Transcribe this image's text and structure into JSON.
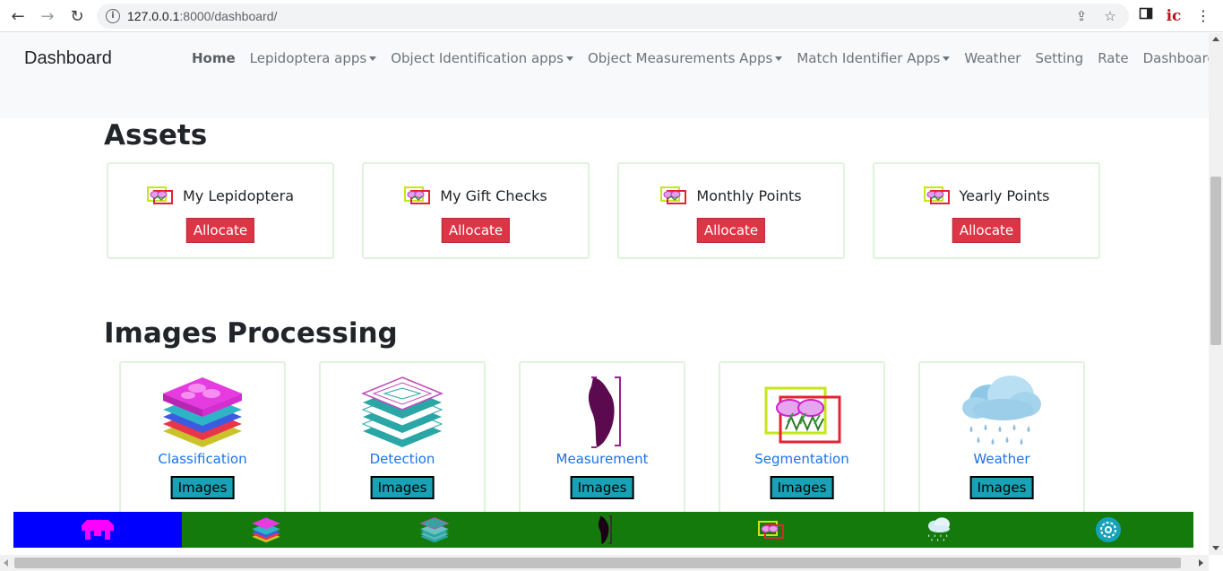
{
  "browser": {
    "url_host": "127.0.0.1",
    "url_rest": ":8000/dashboard/",
    "ext_label": "ic"
  },
  "navbar": {
    "brand": "Dashboard",
    "links": [
      {
        "label": "Home",
        "dropdown": false,
        "active": true
      },
      {
        "label": "Lepidoptera apps",
        "dropdown": true
      },
      {
        "label": "Object Identification apps",
        "dropdown": true
      },
      {
        "label": "Object Measurements Apps",
        "dropdown": true
      },
      {
        "label": "Match Identifier Apps",
        "dropdown": true
      },
      {
        "label": "Weather",
        "dropdown": false
      },
      {
        "label": "Setting",
        "dropdown": false
      },
      {
        "label": "Rate",
        "dropdown": false
      },
      {
        "label": "Dashboard",
        "dropdown": false
      }
    ]
  },
  "assets": {
    "title": "Assets",
    "cards": [
      {
        "name": "My Lepidoptera",
        "button": "Allocate"
      },
      {
        "name": "My Gift Checks",
        "button": "Allocate"
      },
      {
        "name": "Monthly Points",
        "button": "Allocate"
      },
      {
        "name": "Yearly Points",
        "button": "Allocate"
      }
    ]
  },
  "processing": {
    "title": "Images Processing",
    "cards": [
      {
        "label": "Classification",
        "button": "Images",
        "icon": "layered-stack-magenta-icon"
      },
      {
        "label": "Detection",
        "button": "Images",
        "icon": "layered-stack-striped-icon"
      },
      {
        "label": "Measurement",
        "button": "Images",
        "icon": "measurement-silhouette-icon"
      },
      {
        "label": "Segmentation",
        "button": "Images",
        "icon": "segmentation-boxes-icon"
      },
      {
        "label": "Weather",
        "button": "Images",
        "icon": "rain-cloud-icon"
      }
    ]
  },
  "bottom_bar": {
    "colors": {
      "bar": "#157a0c",
      "home": "#0000ff"
    },
    "icons": [
      "home-icon",
      "classification-icon",
      "detection-icon",
      "measurement-icon",
      "segmentation-icon",
      "weather-icon",
      "settings-icon"
    ]
  }
}
